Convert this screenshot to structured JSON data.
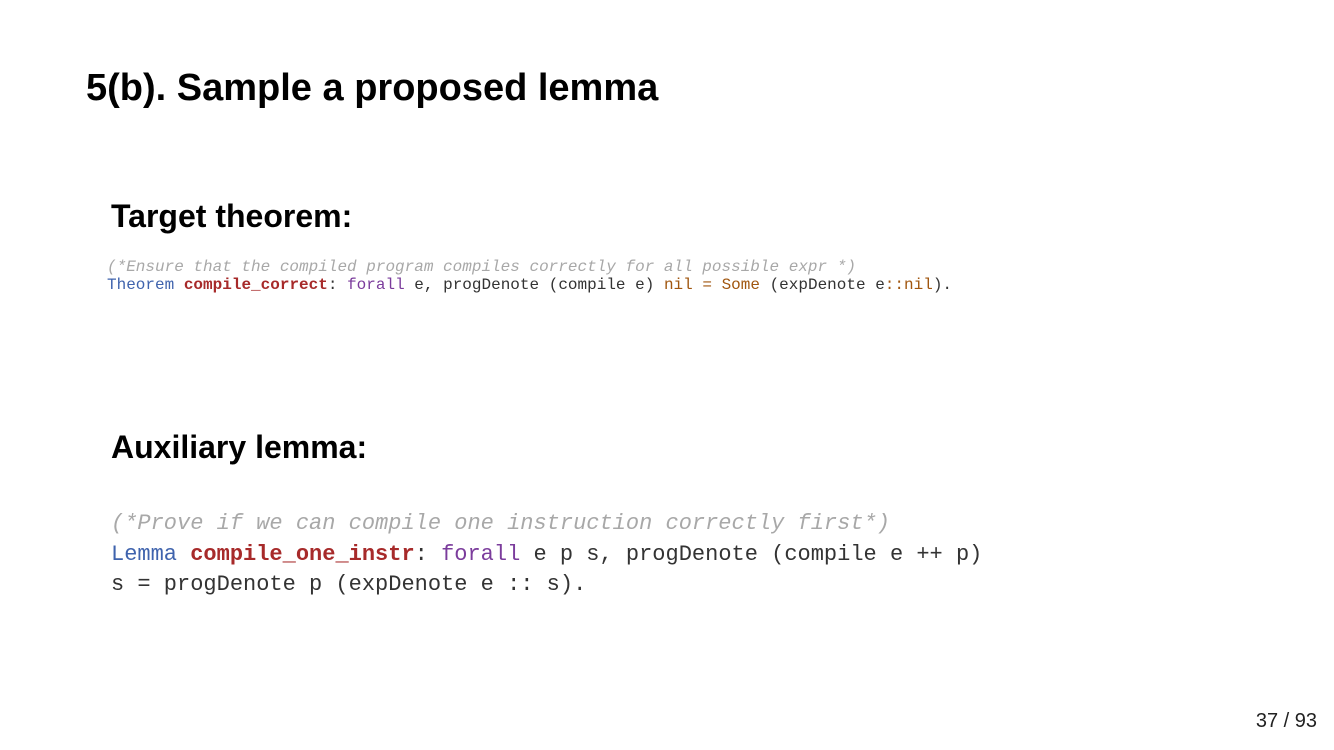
{
  "slide": {
    "title": "5(b). Sample a proposed lemma",
    "page_current": "37",
    "page_separator": " / ",
    "page_total": "93"
  },
  "target": {
    "heading": "Target theorem:",
    "comment": "(*Ensure that the compiled program compiles correctly for all possible expr *)",
    "keyword": "Theorem",
    "name": "compile_correct",
    "colon": ":",
    "forall": "forall",
    "body_1": " e, progDenote (compile e) ",
    "nil_1": "nil",
    "equals": " = ",
    "some": "Some",
    "body_2": " (expDenote e",
    "cons": "::",
    "nil_2": "nil",
    "end": ")."
  },
  "auxiliary": {
    "heading": "Auxiliary lemma:",
    "comment": "(*Prove if we can compile one instruction correctly first*)",
    "keyword": "Lemma",
    "name": "compile_one_instr",
    "colon": ":",
    "forall": "forall",
    "line2_rest": " e p s, progDenote (compile e ++ p)",
    "line3": "s = progDenote p (expDenote e :: s)."
  },
  "colors": {
    "comment": "#a8a8a8",
    "keyword": "#3f63ad",
    "name": "#a72a2a",
    "forall": "#7b3c9c",
    "constant": "#a0560f",
    "text": "#333333"
  }
}
